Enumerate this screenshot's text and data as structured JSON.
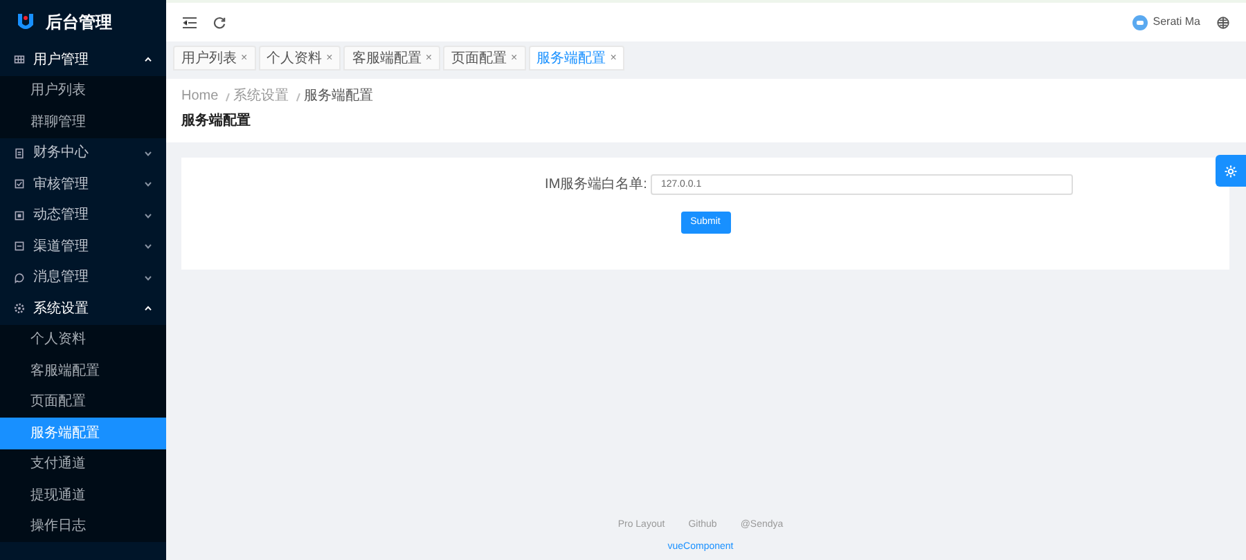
{
  "logo": {
    "title": "后台管理"
  },
  "sidebar": {
    "items": [
      {
        "label": "用户管理",
        "expanded": true,
        "children": [
          {
            "label": "用户列表",
            "selected": false
          },
          {
            "label": "群聊管理",
            "selected": false
          }
        ]
      },
      {
        "label": "财务中心",
        "expanded": false
      },
      {
        "label": "审核管理",
        "expanded": false
      },
      {
        "label": "动态管理",
        "expanded": false
      },
      {
        "label": "渠道管理",
        "expanded": false
      },
      {
        "label": "消息管理",
        "expanded": false
      },
      {
        "label": "系统设置",
        "expanded": true,
        "children": [
          {
            "label": "个人资料",
            "selected": false
          },
          {
            "label": "客服端配置",
            "selected": false
          },
          {
            "label": "页面配置",
            "selected": false
          },
          {
            "label": "服务端配置",
            "selected": true
          },
          {
            "label": "支付通道",
            "selected": false
          },
          {
            "label": "提现通道",
            "selected": false
          },
          {
            "label": "操作日志",
            "selected": false
          }
        ]
      }
    ]
  },
  "header": {
    "user": "Serati Ma"
  },
  "tabs": [
    {
      "label": "用户列表",
      "close": "×",
      "selected": false
    },
    {
      "label": "个人资料",
      "close": "×",
      "selected": false
    },
    {
      "label": "客服端配置",
      "close": "×",
      "selected": false
    },
    {
      "label": "页面配置",
      "close": "×",
      "selected": false
    },
    {
      "label": "服务端配置",
      "close": "×",
      "selected": true
    }
  ],
  "breadcrumb": [
    "Home",
    "系统设置",
    "服务端配置"
  ],
  "page_title": "服务端配置",
  "form": {
    "label": "IM服务端白名单:",
    "value": "127.0.0.1",
    "submit": "Submit"
  },
  "footer": {
    "links": [
      "Pro Layout",
      "Github",
      "@Sendya"
    ],
    "credit": "vueComponent"
  }
}
